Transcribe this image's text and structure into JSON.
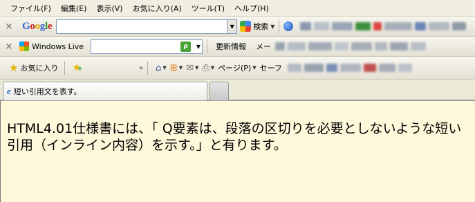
{
  "menubar": {
    "items": [
      "ファイル(F)",
      "編集(E)",
      "表示(V)",
      "お気に入り(A)",
      "ツール(T)",
      "ヘルプ(H)"
    ]
  },
  "google_toolbar": {
    "logo": "Google",
    "search_value": "",
    "search_label": "検索"
  },
  "live_toolbar": {
    "logo_text": "Windows Live",
    "search_value": "",
    "update_label": "更新情報",
    "mail_label": "メー"
  },
  "favorites_bar": {
    "favorites_label": "お気に入り",
    "page_label": "ページ(P)",
    "safety_label": "セーフ"
  },
  "tabs": [
    {
      "title": "短い引用文を表す。",
      "active": true
    }
  ],
  "content": {
    "paragraph": "HTML4.01仕様書には、「 Q要素は、段落の区切りを必要としないような短い引用（インライン内容）を示す。」と有ります。"
  },
  "colors": {
    "content_bg": "#fff9dc",
    "chrome_bg": "#ece9d8"
  }
}
